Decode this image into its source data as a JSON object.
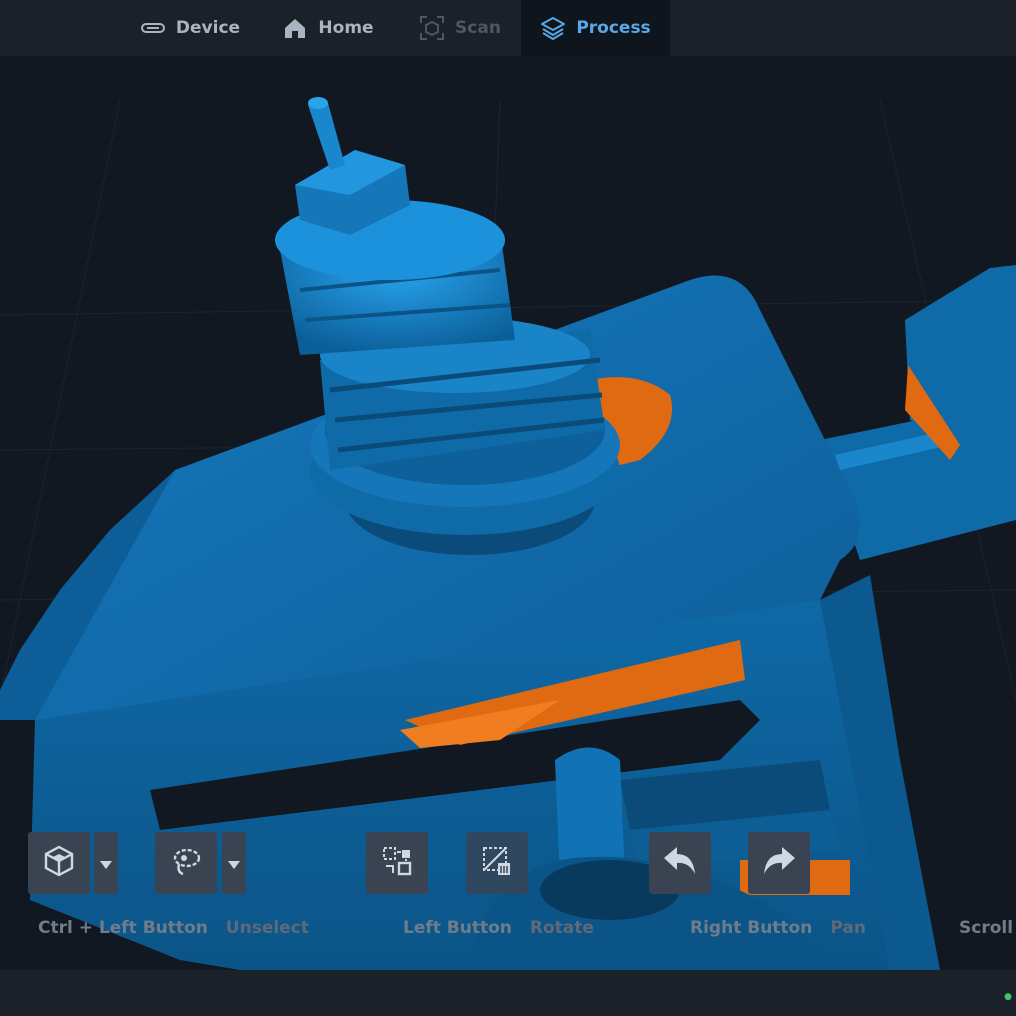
{
  "nav": {
    "tabs": [
      {
        "label": "Device",
        "icon": "device-icon"
      },
      {
        "label": "Home",
        "icon": "home-icon"
      },
      {
        "label": "Scan",
        "icon": "scan-icon"
      },
      {
        "label": "Process",
        "icon": "layers-icon"
      }
    ],
    "active_tab": "Process"
  },
  "toolbar": {
    "tools": [
      {
        "name": "view-cube-tool",
        "icon": "cube-icon"
      },
      {
        "name": "lasso-select-tool",
        "icon": "lasso-icon"
      },
      {
        "name": "invert-select-tool",
        "icon": "swap-select-icon"
      },
      {
        "name": "delete-selection-tool",
        "icon": "delete-selection-icon"
      },
      {
        "name": "undo-tool",
        "icon": "undo-icon"
      },
      {
        "name": "redo-tool",
        "icon": "redo-icon"
      }
    ]
  },
  "hints": [
    {
      "key": "Ctrl + Left Button",
      "action": "Unselect"
    },
    {
      "key": "Left Button",
      "action": "Rotate"
    },
    {
      "key": "Right Button",
      "action": "Pan"
    },
    {
      "key": "Scroll",
      "action": ""
    }
  ],
  "colors": {
    "mesh": "#0f6fb2",
    "mesh_highlight": "#2a9be0",
    "selection": "#e06a12",
    "accent": "#5aa7e8",
    "background": "#111821"
  }
}
